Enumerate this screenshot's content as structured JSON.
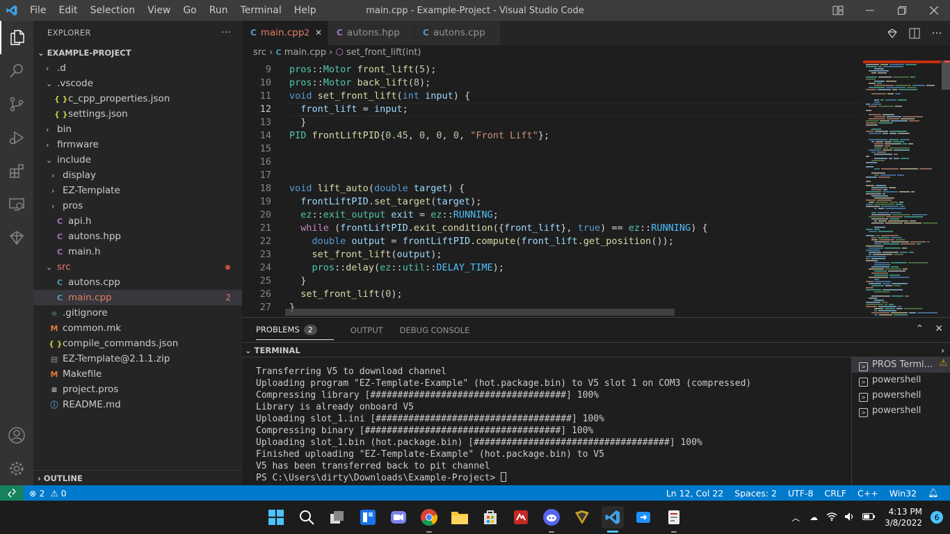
{
  "window": {
    "title": "main.cpp - Example-Project - Visual Studio Code",
    "menu": [
      "File",
      "Edit",
      "Selection",
      "View",
      "Go",
      "Run",
      "Terminal",
      "Help"
    ]
  },
  "sidebar": {
    "title": "EXPLORER",
    "project": "EXAMPLE-PROJECT",
    "outline": "OUTLINE",
    "items": [
      {
        "label": ".d",
        "kind": "folder",
        "indent": 1,
        "open": false
      },
      {
        "label": ".vscode",
        "kind": "folder",
        "indent": 1,
        "open": true
      },
      {
        "label": "c_cpp_properties.json",
        "kind": "json",
        "indent": 2
      },
      {
        "label": "settings.json",
        "kind": "json",
        "indent": 2
      },
      {
        "label": "bin",
        "kind": "folder",
        "indent": 1,
        "open": false
      },
      {
        "label": "firmware",
        "kind": "folder",
        "indent": 1,
        "open": false
      },
      {
        "label": "include",
        "kind": "folder",
        "indent": 1,
        "open": true
      },
      {
        "label": "display",
        "kind": "folder",
        "indent": 2,
        "open": false
      },
      {
        "label": "EZ-Template",
        "kind": "folder",
        "indent": 2,
        "open": false
      },
      {
        "label": "pros",
        "kind": "folder",
        "indent": 2,
        "open": false
      },
      {
        "label": "api.h",
        "kind": "h",
        "indent": 2
      },
      {
        "label": "autons.hpp",
        "kind": "hpp",
        "indent": 2
      },
      {
        "label": "main.h",
        "kind": "h",
        "indent": 2
      },
      {
        "label": "src",
        "kind": "folder",
        "indent": 1,
        "open": true,
        "modified": true
      },
      {
        "label": "autons.cpp",
        "kind": "cpp",
        "indent": 2
      },
      {
        "label": "main.cpp",
        "kind": "cpp",
        "indent": 2,
        "selected": true,
        "badge": "2"
      },
      {
        "label": ".gitignore",
        "kind": "git",
        "indent": 1
      },
      {
        "label": "common.mk",
        "kind": "mk",
        "indent": 1
      },
      {
        "label": "compile_commands.json",
        "kind": "json",
        "indent": 1
      },
      {
        "label": "EZ-Template@2.1.1.zip",
        "kind": "zip",
        "indent": 1
      },
      {
        "label": "Makefile",
        "kind": "mk",
        "indent": 1
      },
      {
        "label": "project.pros",
        "kind": "txt",
        "indent": 1
      },
      {
        "label": "README.md",
        "kind": "info",
        "indent": 1
      }
    ]
  },
  "tabs": [
    {
      "label": "main.cpp",
      "badge": "2",
      "active": true
    },
    {
      "label": "autons.hpp",
      "active": false
    },
    {
      "label": "autons.cpp",
      "active": false
    }
  ],
  "breadcrumb": {
    "folder": "src",
    "file": "main.cpp",
    "symbol": "set_front_lift(int)"
  },
  "editor": {
    "current_line": 12,
    "lines": [
      {
        "n": "9",
        "tokens": [
          [
            "ns",
            "pros"
          ],
          [
            "",
            "::"
          ],
          [
            "ty",
            "Motor"
          ],
          [
            "",
            " "
          ],
          [
            "fn",
            "front_lift"
          ],
          [
            "",
            "("
          ],
          [
            "nu",
            "5"
          ],
          [
            "",
            ");"
          ]
        ]
      },
      {
        "n": "10",
        "tokens": [
          [
            "ns",
            "pros"
          ],
          [
            "",
            "::"
          ],
          [
            "ty",
            "Motor"
          ],
          [
            "",
            " "
          ],
          [
            "fn",
            "back_lift"
          ],
          [
            "",
            "("
          ],
          [
            "nu",
            "8"
          ],
          [
            "",
            ");"
          ]
        ]
      },
      {
        "n": "11",
        "tokens": [
          [
            "kw",
            "void"
          ],
          [
            "",
            " "
          ],
          [
            "fn",
            "set_front_lift"
          ],
          [
            "",
            "("
          ],
          [
            "kw",
            "int"
          ],
          [
            "",
            " "
          ],
          [
            "va",
            "input"
          ],
          [
            "",
            ") {"
          ]
        ]
      },
      {
        "n": "12",
        "tokens": [
          [
            "",
            "  "
          ],
          [
            "va",
            "front_lift"
          ],
          [
            "",
            " = "
          ],
          [
            "va",
            "input"
          ],
          [
            "",
            ";"
          ]
        ]
      },
      {
        "n": "13",
        "tokens": [
          [
            "",
            "  }"
          ]
        ]
      },
      {
        "n": "14",
        "tokens": [
          [
            "ty",
            "PID"
          ],
          [
            "",
            " "
          ],
          [
            "fn",
            "frontLiftPID"
          ],
          [
            "",
            "{"
          ],
          [
            "nu",
            "0.45"
          ],
          [
            "",
            ", "
          ],
          [
            "nu",
            "0"
          ],
          [
            "",
            ", "
          ],
          [
            "nu",
            "0"
          ],
          [
            "",
            ", "
          ],
          [
            "nu",
            "0"
          ],
          [
            "",
            ", "
          ],
          [
            "st",
            "\"Front Lift\""
          ],
          [
            "",
            "};"
          ]
        ]
      },
      {
        "n": "15",
        "tokens": []
      },
      {
        "n": "16",
        "tokens": []
      },
      {
        "n": "17",
        "tokens": []
      },
      {
        "n": "18",
        "tokens": [
          [
            "kw",
            "void"
          ],
          [
            "",
            " "
          ],
          [
            "fn",
            "lift_auto"
          ],
          [
            "",
            "("
          ],
          [
            "kw",
            "double"
          ],
          [
            "",
            " "
          ],
          [
            "va",
            "target"
          ],
          [
            "",
            ") {"
          ]
        ]
      },
      {
        "n": "19",
        "tokens": [
          [
            "",
            "  "
          ],
          [
            "va",
            "frontLiftPID"
          ],
          [
            "",
            "."
          ],
          [
            "fn",
            "set_target"
          ],
          [
            "",
            "("
          ],
          [
            "va",
            "target"
          ],
          [
            "",
            ");"
          ]
        ]
      },
      {
        "n": "20",
        "tokens": [
          [
            "",
            "  "
          ],
          [
            "ns",
            "ez"
          ],
          [
            "",
            "::"
          ],
          [
            "ty",
            "exit_output"
          ],
          [
            "",
            " "
          ],
          [
            "va",
            "exit"
          ],
          [
            "",
            " = "
          ],
          [
            "ns",
            "ez"
          ],
          [
            "",
            "::"
          ],
          [
            "en",
            "RUNNING"
          ],
          [
            "",
            ";"
          ]
        ]
      },
      {
        "n": "21",
        "tokens": [
          [
            "",
            "  "
          ],
          [
            "ctl",
            "while"
          ],
          [
            "",
            " ("
          ],
          [
            "va",
            "frontLiftPID"
          ],
          [
            "",
            "."
          ],
          [
            "fn",
            "exit_condition"
          ],
          [
            "",
            "({"
          ],
          [
            "va",
            "front_lift"
          ],
          [
            "",
            "}, "
          ],
          [
            "kw",
            "true"
          ],
          [
            "",
            ") == "
          ],
          [
            "ns",
            "ez"
          ],
          [
            "",
            "::"
          ],
          [
            "en",
            "RUNNING"
          ],
          [
            "",
            ") {"
          ]
        ]
      },
      {
        "n": "22",
        "tokens": [
          [
            "",
            "    "
          ],
          [
            "kw",
            "double"
          ],
          [
            "",
            " "
          ],
          [
            "va",
            "output"
          ],
          [
            "",
            " = "
          ],
          [
            "va",
            "frontLiftPID"
          ],
          [
            "",
            "."
          ],
          [
            "fn",
            "compute"
          ],
          [
            "",
            "("
          ],
          [
            "va",
            "front_lift"
          ],
          [
            "",
            "."
          ],
          [
            "fn",
            "get_position"
          ],
          [
            "",
            "());"
          ]
        ]
      },
      {
        "n": "23",
        "tokens": [
          [
            "",
            "    "
          ],
          [
            "fn",
            "set_front_lift"
          ],
          [
            "",
            "("
          ],
          [
            "va",
            "output"
          ],
          [
            "",
            ");"
          ]
        ]
      },
      {
        "n": "24",
        "tokens": [
          [
            "",
            "    "
          ],
          [
            "ns",
            "pros"
          ],
          [
            "",
            "::"
          ],
          [
            "fn",
            "delay"
          ],
          [
            "",
            "("
          ],
          [
            "ns",
            "ez"
          ],
          [
            "",
            "::"
          ],
          [
            "ns",
            "util"
          ],
          [
            "",
            "::"
          ],
          [
            "en",
            "DELAY_TIME"
          ],
          [
            "",
            ");"
          ]
        ]
      },
      {
        "n": "25",
        "tokens": [
          [
            "",
            "  }"
          ]
        ]
      },
      {
        "n": "26",
        "tokens": [
          [
            "",
            "  "
          ],
          [
            "fn",
            "set_front_lift"
          ],
          [
            "",
            "("
          ],
          [
            "nu",
            "0"
          ],
          [
            "",
            ");"
          ]
        ]
      },
      {
        "n": "27",
        "tokens": [
          [
            "",
            "}"
          ]
        ]
      }
    ]
  },
  "panel": {
    "tabs": [
      {
        "label": "PROBLEMS",
        "count": "2",
        "active": true
      },
      {
        "label": "OUTPUT"
      },
      {
        "label": "DEBUG CONSOLE"
      }
    ],
    "terminal_header": "TERMINAL",
    "terminal_lines": [
      "Transferring V5 to download channel",
      "Uploading program \"EZ-Template-Example\" (hot.package.bin) to V5 slot 1 on COM3 (compressed)",
      "Compressing library [####################################] 100%",
      "Library is already onboard V5",
      "Uploading slot_1.ini [####################################] 100%",
      "Compressing binary [####################################] 100%",
      "Uploading slot_1.bin (hot.package.bin) [####################################] 100%",
      "Finished uploading \"EZ-Template-Example\" (hot.package.bin) to V5",
      "V5 has been transferred back to pit channel",
      "PS C:\\Users\\dirty\\Downloads\\Example-Project> "
    ],
    "terminals": [
      "PROS Termi...",
      "powershell",
      "powershell",
      "powershell"
    ]
  },
  "status": {
    "errors": "2",
    "warnings": "0",
    "position": "Ln 12, Col 22",
    "spaces": "Spaces: 2",
    "encoding": "UTF-8",
    "eol": "CRLF",
    "language": "C++",
    "platform": "Win32"
  },
  "taskbar": {
    "time": "4:13 PM",
    "date": "3/8/2022",
    "notifications": "6"
  },
  "colors": {
    "accent": "#007acc",
    "remote": "#16825d",
    "modified": "#c74e39"
  }
}
